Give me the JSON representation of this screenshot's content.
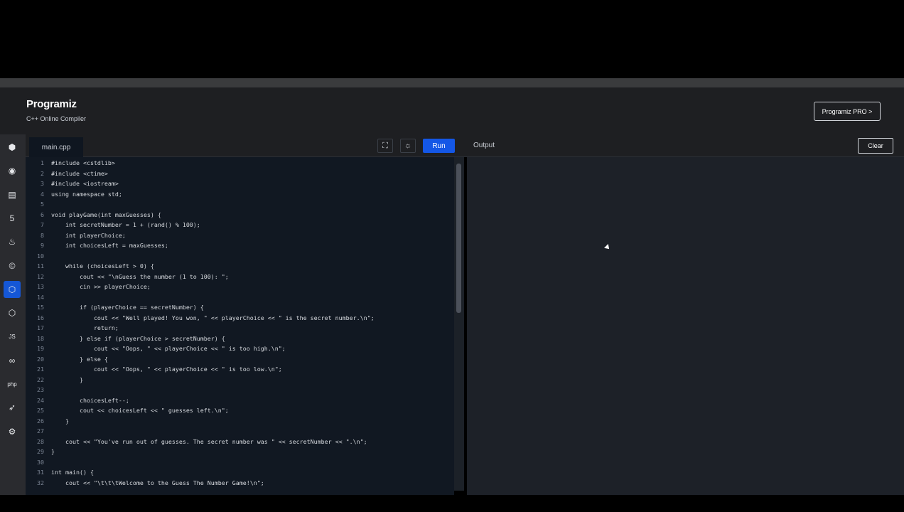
{
  "header": {
    "logo": "Programiz",
    "subtitle": "C++ Online Compiler",
    "pro_button": "Programiz PRO >"
  },
  "sidebar": {
    "items": [
      {
        "name": "python-icon",
        "glyph": "⬢"
      },
      {
        "name": "r-icon",
        "glyph": "◉"
      },
      {
        "name": "sql-icon",
        "glyph": "▤"
      },
      {
        "name": "html-icon",
        "glyph": "5"
      },
      {
        "name": "java-icon",
        "glyph": "♨"
      },
      {
        "name": "c-icon",
        "glyph": "©"
      },
      {
        "name": "cpp-icon",
        "glyph": "⬡",
        "active": true
      },
      {
        "name": "csharp-icon",
        "glyph": "⬡"
      },
      {
        "name": "js-icon",
        "glyph": "JS"
      },
      {
        "name": "go-icon",
        "glyph": "∞"
      },
      {
        "name": "php-icon",
        "glyph": "php"
      },
      {
        "name": "swift-icon",
        "glyph": "➶"
      },
      {
        "name": "rust-icon",
        "glyph": "⚙"
      }
    ]
  },
  "editor": {
    "tab_label": "main.cpp",
    "run_label": "Run",
    "fullscreen_glyph": "⛶",
    "theme_glyph": "☼",
    "lines": [
      {
        "n": "1",
        "t": "#include <cstdlib>"
      },
      {
        "n": "2",
        "t": "#include <ctime>"
      },
      {
        "n": "3",
        "t": "#include <iostream>"
      },
      {
        "n": "4",
        "t": "using namespace std;"
      },
      {
        "n": "5",
        "t": ""
      },
      {
        "n": "6",
        "t": "void playGame(int maxGuesses) {"
      },
      {
        "n": "7",
        "t": "    int secretNumber = 1 + (rand() % 100);"
      },
      {
        "n": "8",
        "t": "    int playerChoice;"
      },
      {
        "n": "9",
        "t": "    int choicesLeft = maxGuesses;"
      },
      {
        "n": "10",
        "t": ""
      },
      {
        "n": "11",
        "t": "    while (choicesLeft > 0) {"
      },
      {
        "n": "12",
        "t": "        cout << \"\\nGuess the number (1 to 100): \";"
      },
      {
        "n": "13",
        "t": "        cin >> playerChoice;"
      },
      {
        "n": "14",
        "t": ""
      },
      {
        "n": "15",
        "t": "        if (playerChoice == secretNumber) {"
      },
      {
        "n": "16",
        "t": "            cout << \"Well played! You won, \" << playerChoice << \" is the secret number.\\n\";"
      },
      {
        "n": "17",
        "t": "            return;"
      },
      {
        "n": "18",
        "t": "        } else if (playerChoice > secretNumber) {"
      },
      {
        "n": "19",
        "t": "            cout << \"Oops, \" << playerChoice << \" is too high.\\n\";"
      },
      {
        "n": "20",
        "t": "        } else {"
      },
      {
        "n": "21",
        "t": "            cout << \"Oops, \" << playerChoice << \" is too low.\\n\";"
      },
      {
        "n": "22",
        "t": "        }"
      },
      {
        "n": "23",
        "t": ""
      },
      {
        "n": "24",
        "t": "        choicesLeft--;"
      },
      {
        "n": "25",
        "t": "        cout << choicesLeft << \" guesses left.\\n\";"
      },
      {
        "n": "26",
        "t": "    }"
      },
      {
        "n": "27",
        "t": ""
      },
      {
        "n": "28",
        "t": "    cout << \"You've run out of guesses. The secret number was \" << secretNumber << \".\\n\";"
      },
      {
        "n": "29",
        "t": "}"
      },
      {
        "n": "30",
        "t": ""
      },
      {
        "n": "31",
        "t": "int main() {"
      },
      {
        "n": "32",
        "t": "    cout << \"\\t\\t\\tWelcome to the Guess The Number Game!\\n\";"
      }
    ]
  },
  "output": {
    "label": "Output",
    "clear_label": "Clear"
  }
}
